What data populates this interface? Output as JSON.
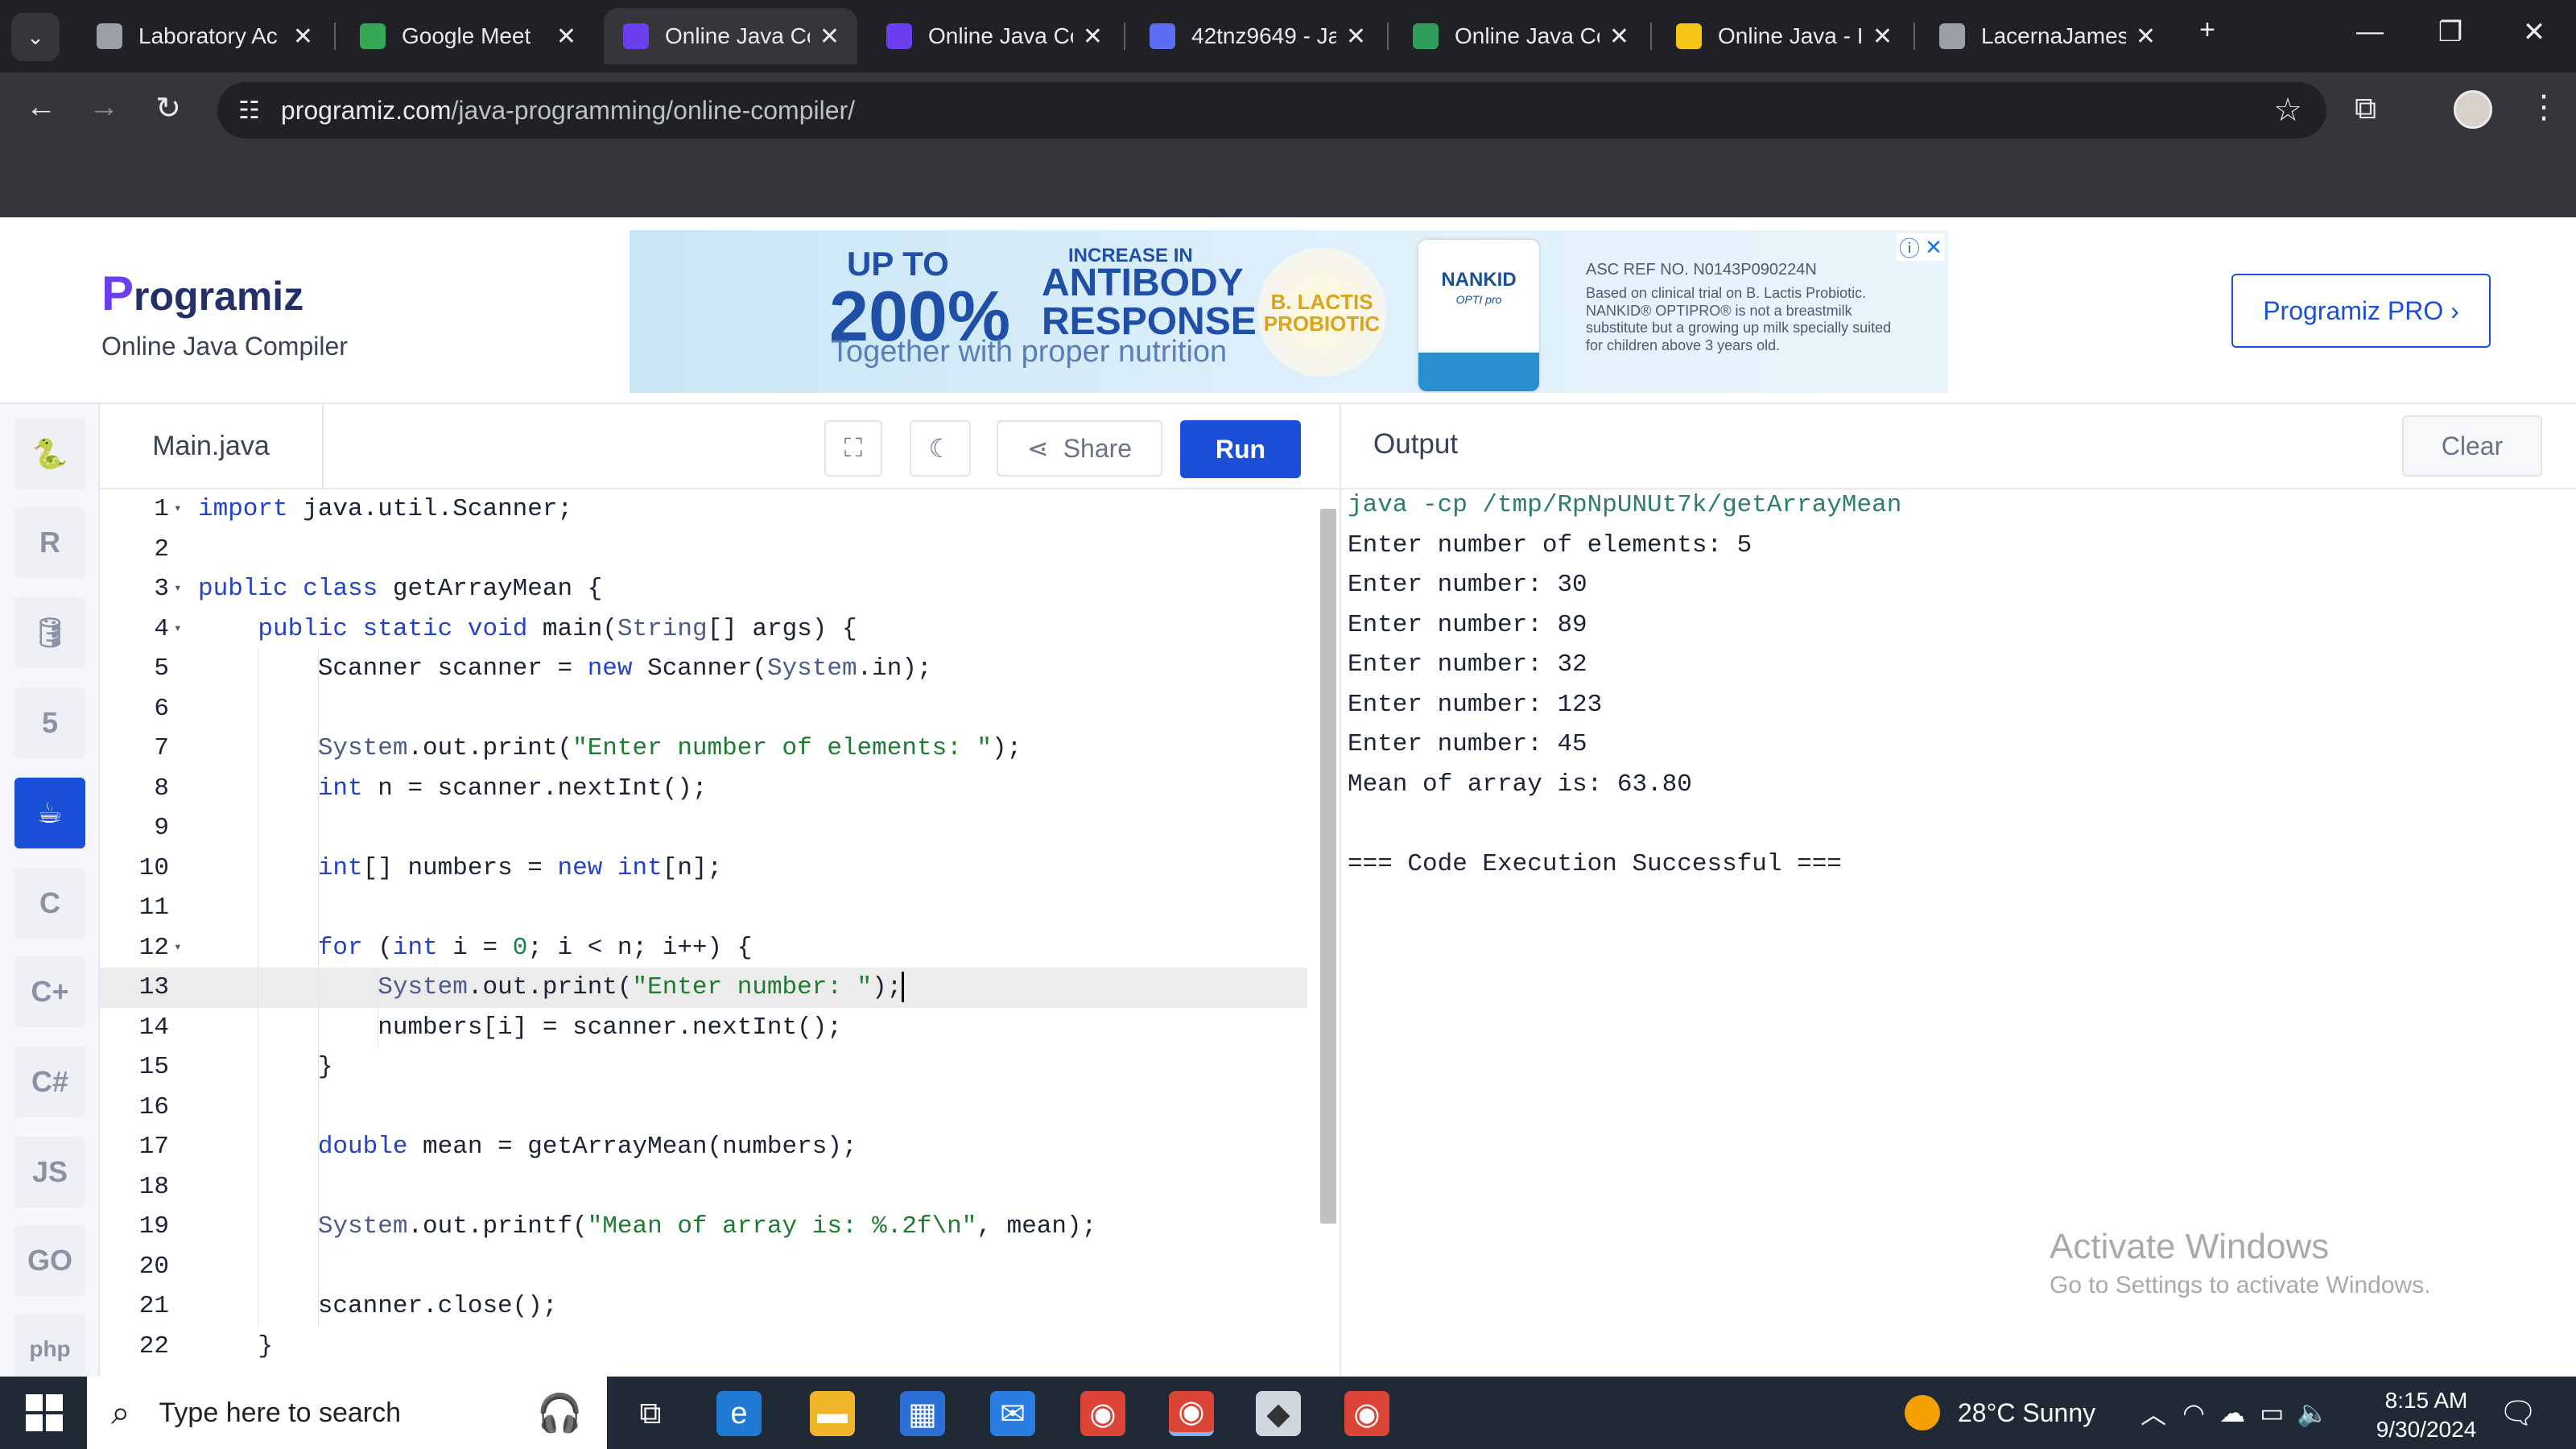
{
  "browser": {
    "tabs": [
      {
        "title": "Laboratory Ac",
        "favicon_color": "#9aa0a6",
        "active": false
      },
      {
        "title": "Google Meet",
        "favicon_color": "#34a853",
        "active": false
      },
      {
        "title": "Online Java Co",
        "favicon_color": "#6b3ff0",
        "active": true
      },
      {
        "title": "Online Java Co",
        "favicon_color": "#6b3ff0",
        "active": false
      },
      {
        "title": "42tnz9649 - Ja",
        "favicon_color": "#5b6cf5",
        "active": false
      },
      {
        "title": "Online Java Co",
        "favicon_color": "#2e9e5b",
        "active": false
      },
      {
        "title": "Online Java - I",
        "favicon_color": "#f5c518",
        "active": false
      },
      {
        "title": "LacernaJames",
        "favicon_color": "#9aa0a6",
        "active": false
      }
    ],
    "new_tab_label": "+",
    "address": {
      "host": "programiz.com",
      "path": "/java-programming/online-compiler/"
    }
  },
  "header": {
    "logo_mark": "P",
    "logo_text": "rogramiz",
    "subtitle": "Online Java Compiler",
    "pro_button": "Programiz PRO ›"
  },
  "ad": {
    "up_to": "UP TO",
    "percent": "200%",
    "increase": "INCREASE IN",
    "antibody": "ANTIBODY",
    "response": "RESPONSE",
    "tagline": "Together with proper nutrition",
    "probiotic": "B. LACTIS PROBIOTIC",
    "product_brand": "NANKID",
    "product_sub": "OPTI pro",
    "ref": "ASC REF NO. N0143P090224N",
    "fine_print": "Based on clinical trial on B. Lactis Probiotic. NANKID® OPTIPRO® is not a breastmilk substitute but a growing up milk specially suited for children above 3 years old."
  },
  "sidebar": {
    "languages": [
      {
        "name": "python-icon",
        "glyph": "🐍"
      },
      {
        "name": "r-icon",
        "glyph": "R"
      },
      {
        "name": "sql-icon",
        "glyph": "🛢"
      },
      {
        "name": "html-icon",
        "glyph": "5"
      },
      {
        "name": "java-icon",
        "glyph": "☕",
        "active": true
      },
      {
        "name": "c-icon",
        "glyph": "C"
      },
      {
        "name": "cpp-icon",
        "glyph": "C+"
      },
      {
        "name": "csharp-icon",
        "glyph": "C#"
      },
      {
        "name": "js-icon",
        "glyph": "JS"
      },
      {
        "name": "go-icon",
        "glyph": "GO"
      },
      {
        "name": "php-icon",
        "glyph": "php"
      }
    ]
  },
  "editor": {
    "file_name": "Main.java",
    "share_label": "Share",
    "run_label": "Run",
    "current_line": 13,
    "lines": [
      "import java.util.Scanner;",
      "",
      "public class getArrayMean {",
      "    public static void main(String[] args) {",
      "        Scanner scanner = new Scanner(System.in);",
      "",
      "        System.out.print(\"Enter number of elements: \");",
      "        int n = scanner.nextInt();",
      "",
      "        int[] numbers = new int[n];",
      "",
      "        for (int i = 0; i < n; i++) {",
      "            System.out.print(\"Enter number: \");",
      "            numbers[i] = scanner.nextInt();",
      "        }",
      "",
      "        double mean = getArrayMean(numbers);",
      "",
      "        System.out.printf(\"Mean of array is: %.2f\\n\", mean);",
      "",
      "        scanner.close();",
      "    }"
    ],
    "fold_lines": [
      1,
      3,
      4,
      12
    ]
  },
  "output": {
    "title": "Output",
    "clear_label": "Clear",
    "lines": [
      "java -cp /tmp/RpNpUNUt7k/getArrayMean",
      "Enter number of elements: 5",
      "Enter number: 30",
      "Enter number: 89",
      "Enter number: 32",
      "Enter number: 123",
      "Enter number: 45",
      "Mean of array is: 63.80",
      "",
      "=== Code Execution Successful ==="
    ]
  },
  "watermark": {
    "line1": "Activate Windows",
    "line2": "Go to Settings to activate Windows."
  },
  "taskbar": {
    "search_placeholder": "Type here to search",
    "weather": "28°C  Sunny",
    "time": "8:15 AM",
    "date": "9/30/2024"
  },
  "colors": {
    "accent": "#1a4fd8",
    "logo_purple": "#6b3ff0",
    "keyword": "#2342c8",
    "string": "#1e7b2f"
  }
}
